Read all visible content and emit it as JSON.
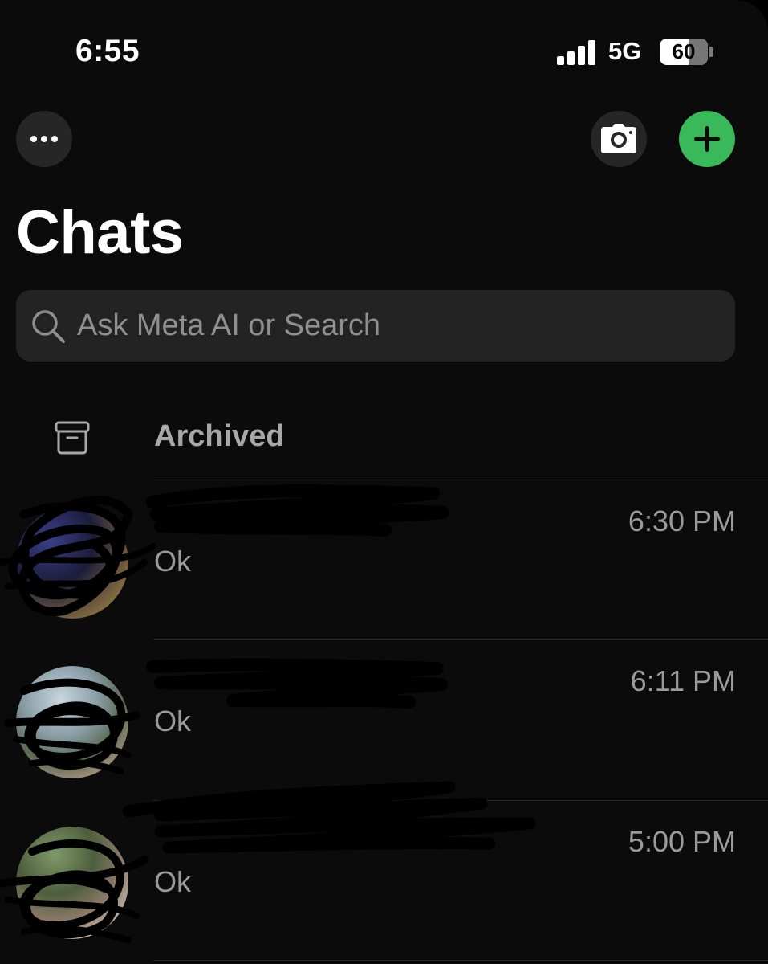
{
  "status_bar": {
    "time": "6:55",
    "network": "5G",
    "battery": "60"
  },
  "header": {
    "more_icon": "ellipsis-icon",
    "camera_icon": "camera-icon",
    "compose_icon": "plus-icon",
    "title": "Chats"
  },
  "search": {
    "placeholder": "Ask Meta AI or Search"
  },
  "archived": {
    "label": "Archived",
    "icon": "archive-box-icon"
  },
  "chats": [
    {
      "preview": "Ok",
      "time": "6:30 PM"
    },
    {
      "preview": "Ok",
      "time": "6:11 PM"
    },
    {
      "preview": "Ok",
      "time": "5:00 PM"
    }
  ],
  "colors": {
    "background": "#0b0b0b",
    "accent": "#3ab95b",
    "secondary_text": "#9a9a9a",
    "button_bg": "#262626"
  }
}
